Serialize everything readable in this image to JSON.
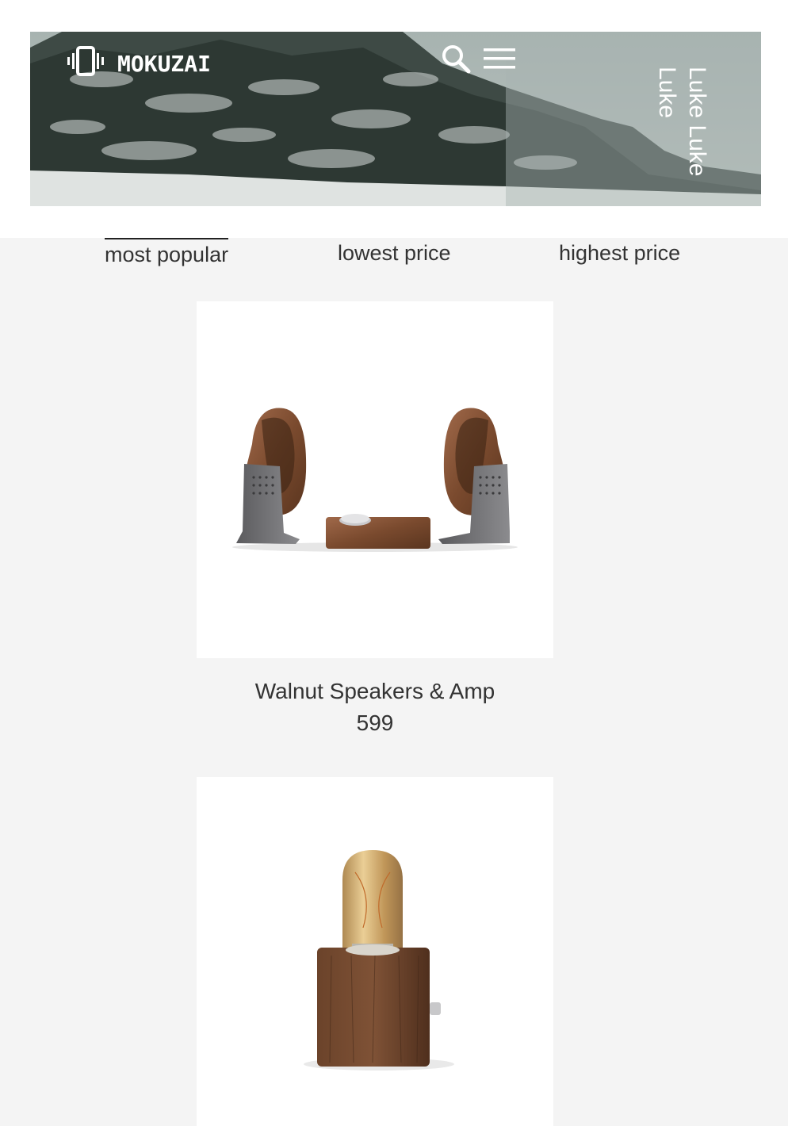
{
  "brand": {
    "name": "MOKUZAI",
    "logo_icon": "vibrate-icon"
  },
  "header": {
    "search_icon": "search-icon",
    "menu_icon": "hamburger-menu-icon",
    "user_name": "Luke Luke Luke"
  },
  "sort": {
    "tabs": [
      {
        "label": "most popular",
        "active": true
      },
      {
        "label": "lowest price",
        "active": false
      },
      {
        "label": "highest price",
        "active": false
      }
    ]
  },
  "products": [
    {
      "name": "Walnut Speakers & Amp",
      "price": "599"
    },
    {
      "name": "",
      "price": ""
    }
  ],
  "colors": {
    "background": "#f4f4f4",
    "card": "#ffffff",
    "text": "#333333",
    "header_text": "#ffffff"
  }
}
